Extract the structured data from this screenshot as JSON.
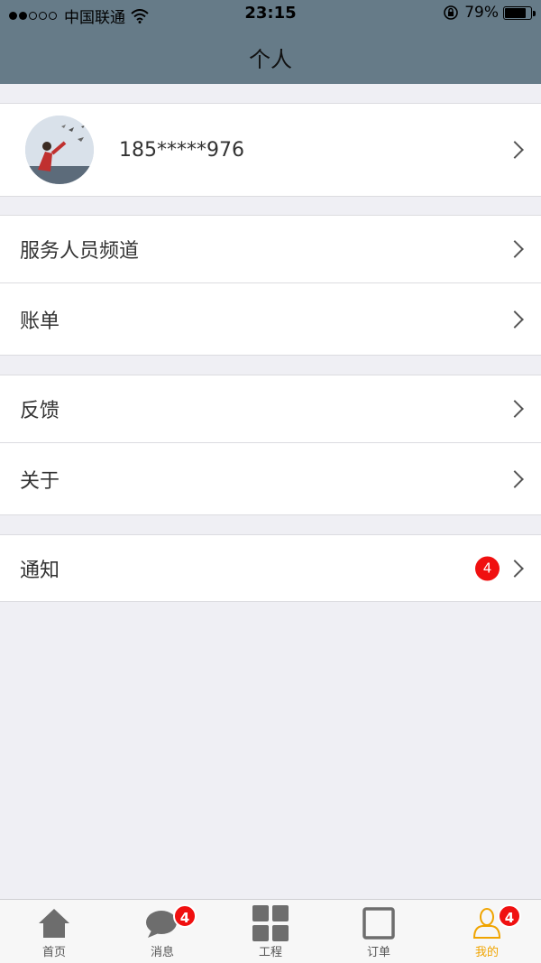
{
  "status_bar": {
    "carrier": "中国联通",
    "time": "23:15",
    "battery": "79%",
    "battery_level": 0.79
  },
  "nav": {
    "title": "个人"
  },
  "profile": {
    "phone": "185*****976"
  },
  "menu_groups": [
    {
      "items": [
        {
          "label": "服务人员频道"
        },
        {
          "label": "账单"
        }
      ]
    },
    {
      "items": [
        {
          "label": "反馈"
        },
        {
          "label": "关于"
        }
      ]
    },
    {
      "items": [
        {
          "label": "通知",
          "badge": "4"
        }
      ]
    }
  ],
  "tabs": [
    {
      "label": "首页",
      "icon": "home-icon"
    },
    {
      "label": "消息",
      "icon": "chat-bubble-icon",
      "badge": "4"
    },
    {
      "label": "工程",
      "icon": "grid-icon"
    },
    {
      "label": "订单",
      "icon": "square-icon"
    },
    {
      "label": "我的",
      "icon": "person-icon",
      "badge": "4",
      "active": true
    }
  ],
  "colors": {
    "header": "#667b88",
    "badge": "#f01010",
    "active_tab": "#f0a400"
  }
}
